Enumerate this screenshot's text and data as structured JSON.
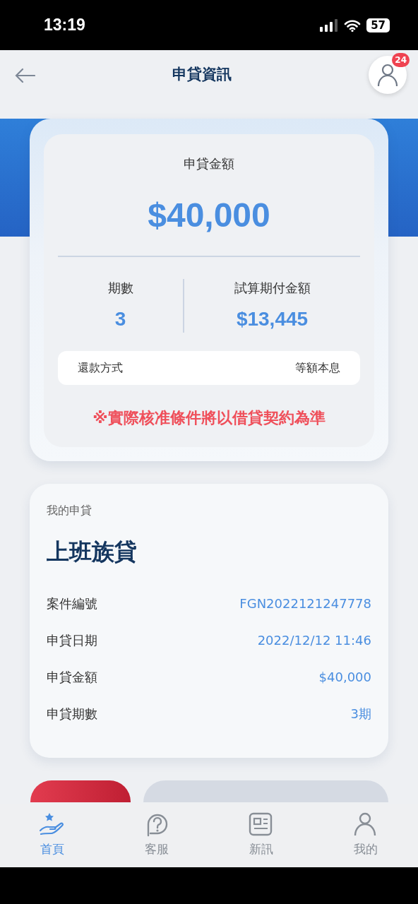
{
  "status_bar": {
    "time": "13:19",
    "battery": "57"
  },
  "header": {
    "title": "申貸資訊",
    "badge": "24"
  },
  "summary": {
    "title": "申貸金額",
    "amount": "$40,000",
    "stats": [
      {
        "label": "期數",
        "value": "3"
      },
      {
        "label": "試算期付金額",
        "value": "$13,445"
      }
    ],
    "method": {
      "label": "還款方式",
      "value": "等額本息"
    },
    "notice": "※實際核准條件將以借貸契約為準"
  },
  "application": {
    "caption": "我的申貸",
    "product": "上班族貸",
    "rows": [
      {
        "label": "案件編號",
        "value": "FGN2022121247778"
      },
      {
        "label": "申貸日期",
        "value": "2022/12/12 11:46"
      },
      {
        "label": "申貸金額",
        "value": "$40,000"
      },
      {
        "label": "申貸期數",
        "value": "3期"
      }
    ]
  },
  "actions": [
    {
      "kind": "danger"
    },
    {
      "kind": "muted"
    }
  ],
  "tabs": [
    {
      "label": "首頁",
      "selected": true
    },
    {
      "label": "客服",
      "selected": false
    },
    {
      "label": "新訊",
      "selected": false
    },
    {
      "label": "我的",
      "selected": false
    }
  ]
}
